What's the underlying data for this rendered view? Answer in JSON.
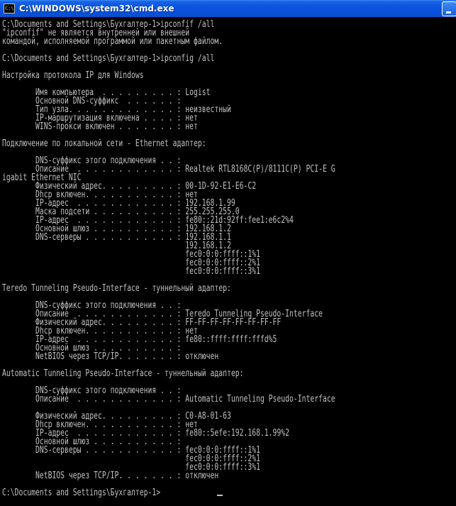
{
  "window": {
    "title": "C:\\WINDOWS\\system32\\cmd.exe",
    "icon_label": "C:\\"
  },
  "console": {
    "lines": [
      "C:\\Documents and Settings\\Бухгалтер-1>ipconfif /all",
      "\"ipconfif\" не является внутренней или внешней",
      "командой, исполняемой программой или пакетным файлом.",
      "",
      "C:\\Documents and Settings\\Бухгалтер-1>ipconfig /all",
      "",
      "Настройка протокола IP для Windows",
      "",
      "        Имя компьютера  . . . . . . . . . : Logist",
      "        Основной DNS-суффикс  . . . . . . :",
      "        Тип узла. . . . . . . . . . . . . : неизвестный",
      "        IP-маршрутизация включена . . . . : нет",
      "        WINS-прокси включен . . . . . . . : нет",
      "",
      "Подключение по локальной сети - Ethernet адаптер:",
      "",
      "        DNS-суффикс этого подключения . . :",
      "        Описание  . . . . . . . . . . . . : Realtek RTL8168C(P)/8111C(P) PCI-E G",
      "igabit Ethernet NIC",
      "        Физический адрес. . . . . . . . . : 00-1D-92-E1-E6-C2",
      "        Dhcp включен. . . . . . . . . . . : нет",
      "        IP-адрес  . . . . . . . . . . . . : 192.168.1.99",
      "        Маска подсети . . . . . . . . . . : 255.255.255.0",
      "        IP-адрес  . . . . . . . . . . . . : fe80::21d:92ff:fee1:e6c2%4",
      "        Основной шлюз . . . . . . . . . . : 192.168.1.2",
      "        DNS-серверы . . . . . . . . . . . : 192.168.1.1",
      "                                            192.168.1.2",
      "                                            fec0:0:0:ffff::1%1",
      "                                            fec0:0:0:ffff::2%1",
      "                                            fec0:0:0:ffff::3%1",
      "",
      "Teredo Tunneling Pseudo-Interface - туннельный адаптер:",
      "",
      "        DNS-суффикс этого подключения . . :",
      "        Описание  . . . . . . . . . . . . : Teredo Tunneling Pseudo-Interface",
      "        Физический адрес. . . . . . . . . : FF-FF-FF-FF-FF-FF-FF-FF",
      "        Dhcp включен. . . . . . . . . . . : нет",
      "        IP-адрес  . . . . . . . . . . . . : fe80::ffff:ffff:fffd%5",
      "        Основной шлюз . . . . . . . . . . :",
      "        NetBIOS через TCP/IP. . . . . . . : отключен",
      "",
      "Automatic Tunneling Pseudo-Interface - туннельный адаптер:",
      "",
      "        DNS-суффикс этого подключения . . :",
      "        Описание  . . . . . . . . . . . . : Automatic Tunneling Pseudo-Interface",
      "",
      "        Физический адрес. . . . . . . . . : C0-A8-01-63",
      "        Dhcp включен. . . . . . . . . . . : нет",
      "        IP-адрес  . . . . . . . . . . . . : fe80::5efe:192.168.1.99%2",
      "        Основной шлюз . . . . . . . . . . :",
      "        DNS-серверы . . . . . . . . . . . : fec0:0:0:ffff::1%1",
      "                                            fec0:0:0:ffff::2%1",
      "                                            fec0:0:0:ffff::3%1",
      "        NetBIOS через TCP/IP. . . . . . . : отключен",
      "",
      "C:\\Documents and Settings\\Бухгалтер-1>"
    ]
  }
}
